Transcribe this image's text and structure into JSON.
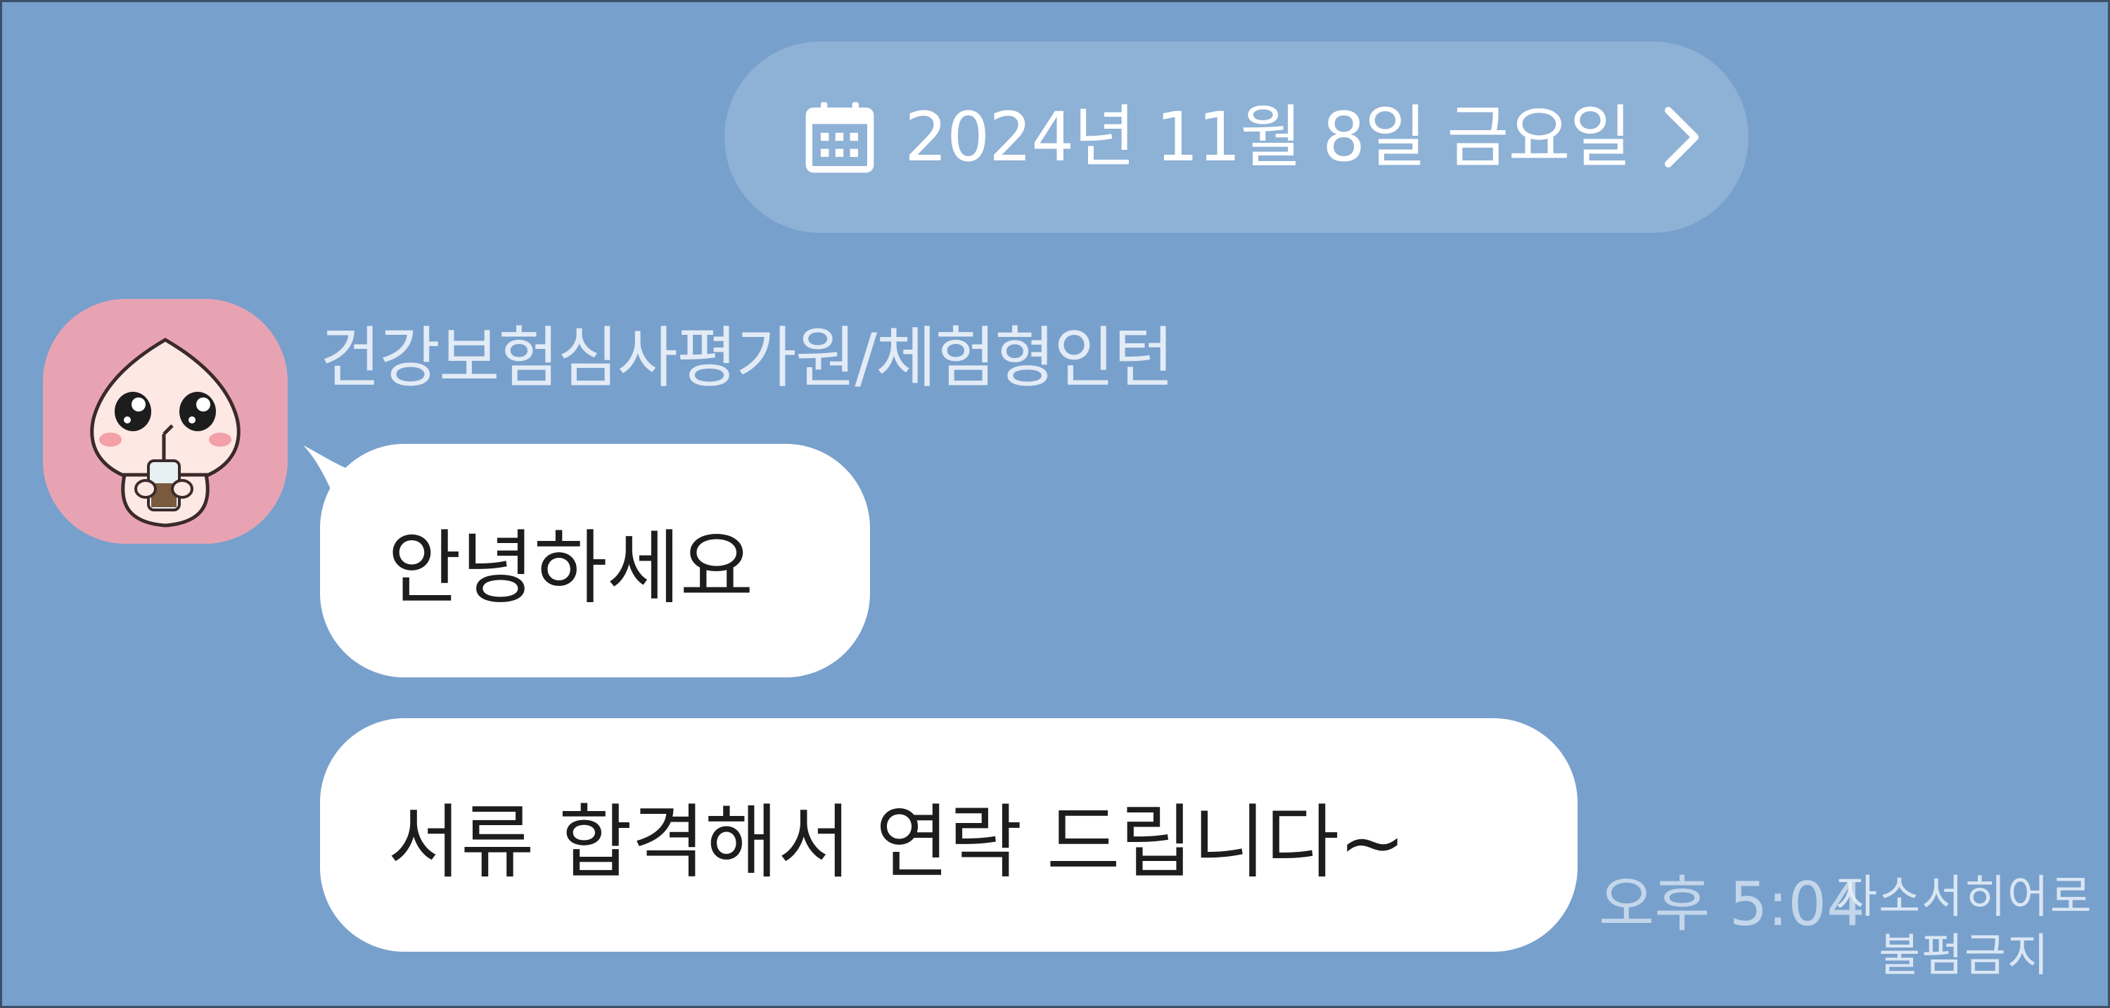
{
  "date_header": {
    "label": "2024년 11월 8일 금요일",
    "icon": "calendar-icon",
    "trailing_icon": "chevron-right-icon"
  },
  "sender": {
    "name": "건강보험심사평가원/체험형인턴",
    "avatar": "peach-character-avatar"
  },
  "messages": [
    {
      "text": "안녕하세요"
    },
    {
      "text": "서류 합격해서 연락 드립니다~"
    }
  ],
  "timestamp": "오후 5:04",
  "watermark": {
    "line1": "자소서히어로",
    "line2": "불펌금지"
  },
  "colors": {
    "background": "#78a0cc",
    "bubble": "#ffffff",
    "avatar_bg": "#e8a3b3"
  }
}
